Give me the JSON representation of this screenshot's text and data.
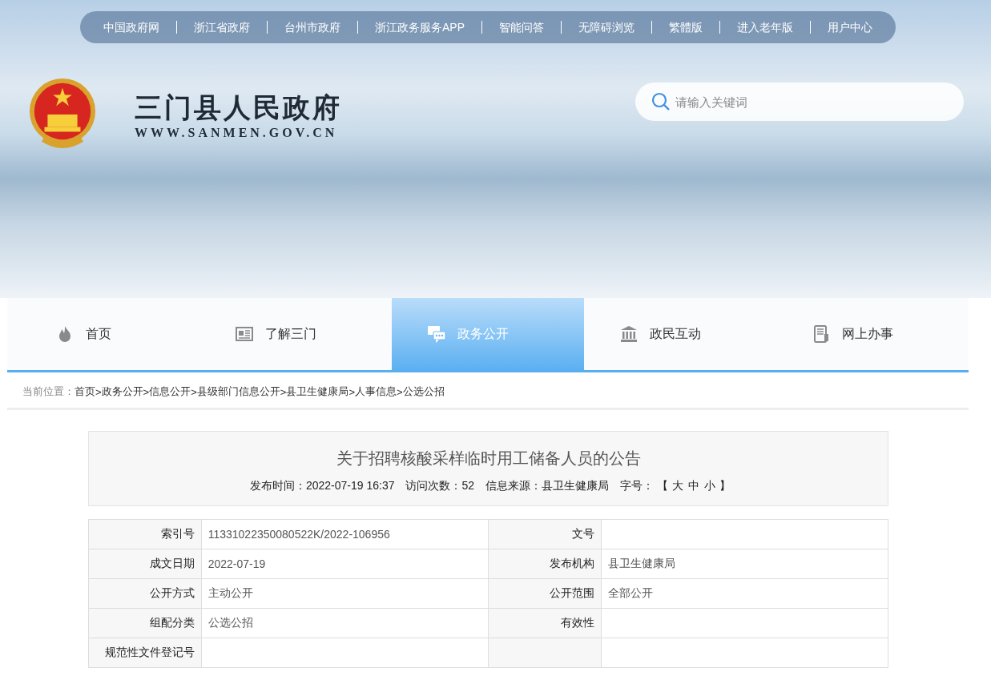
{
  "top_links": [
    {
      "label": "中国政府网"
    },
    {
      "label": "浙江省政府"
    },
    {
      "label": "台州市政府"
    },
    {
      "label": "浙江政务服务APP"
    },
    {
      "label": "智能问答"
    },
    {
      "label": "无障碍浏览"
    },
    {
      "label": "繁體版"
    },
    {
      "label": "进入老年版"
    },
    {
      "label": "用户中心"
    }
  ],
  "site": {
    "title": "三门县人民政府",
    "url": "WWW.SANMEN.GOV.CN"
  },
  "search": {
    "placeholder": "请输入关键词"
  },
  "main_nav": [
    {
      "label": "首页",
      "selected": false
    },
    {
      "label": "了解三门",
      "selected": false
    },
    {
      "label": "政务公开",
      "selected": true
    },
    {
      "label": "政民互动",
      "selected": false
    },
    {
      "label": "网上办事",
      "selected": false
    }
  ],
  "breadcrumb": {
    "label": "当前位置：",
    "items": [
      "首页",
      "政务公开",
      "信息公开",
      "县级部门信息公开",
      "县卫生健康局",
      "人事信息",
      "公选公招"
    ],
    "separators": [
      ">",
      ">",
      ">",
      ">",
      ">",
      ">"
    ]
  },
  "article": {
    "title": "关于招聘核酸采样临时用工储备人员的公告",
    "meta": [
      "发布时间：2022-07-19 16:37",
      "访问次数：52",
      "信息来源：县卫生健康局"
    ],
    "font_size": {
      "label": "字号：",
      "open": "【",
      "options": [
        "大",
        "中",
        "小"
      ],
      "close": "】"
    }
  },
  "info_table": [
    {
      "cells": [
        {
          "label": "索引号",
          "value": "11331022350080522K/2022-106956"
        },
        {
          "label": "文号"
        }
      ]
    },
    {
      "cells": [
        {
          "label": "成文日期",
          "value": "2022-07-19"
        },
        {
          "label": "发布机构",
          "value": "县卫生健康局"
        }
      ]
    },
    {
      "cells": [
        {
          "label": "公开方式",
          "value": "主动公开"
        },
        {
          "label": "公开范围",
          "value": "全部公开"
        }
      ]
    },
    {
      "cells": [
        {
          "label": "组配分类",
          "value": "公选公招"
        },
        {
          "label": "有效性"
        }
      ]
    },
    {
      "cells": [
        {
          "label": "规范性文件登记号"
        },
        {}
      ]
    }
  ]
}
